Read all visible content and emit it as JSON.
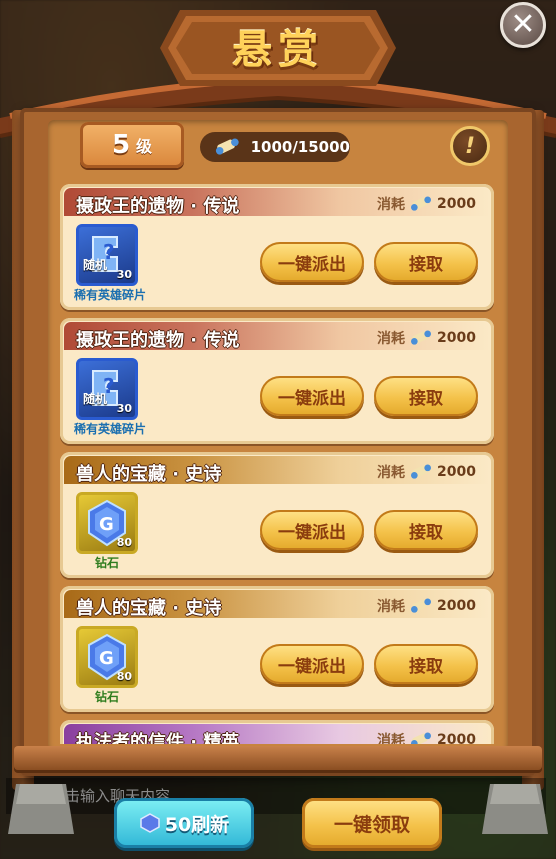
{
  "header": {
    "title": "悬赏",
    "close_icon": "close-icon"
  },
  "level": {
    "number": "5",
    "unit": "级"
  },
  "scrolls": {
    "value": "1000/15000",
    "icon": "scroll-icon"
  },
  "info": {
    "icon": "exclamation-icon",
    "glyph": "!"
  },
  "cost_label": "消耗",
  "quests": [
    {
      "title": "摄政王的遗物 · 传说",
      "tier": "legend",
      "cost": "2000",
      "reward_tag": "随机",
      "reward_count": "30",
      "reward_name": "稀有英雄碎片",
      "reward_kind": "hero",
      "dispatch_label": "一键派出",
      "accept_label": "接取"
    },
    {
      "title": "摄政王的遗物 · 传说",
      "tier": "legend",
      "cost": "2000",
      "reward_tag": "随机",
      "reward_count": "30",
      "reward_name": "稀有英雄碎片",
      "reward_kind": "hero",
      "dispatch_label": "一键派出",
      "accept_label": "接取"
    },
    {
      "title": "兽人的宝藏 · 史诗",
      "tier": "epic",
      "cost": "2000",
      "reward_tag": "",
      "reward_count": "80",
      "reward_name": "钻石",
      "reward_kind": "gem",
      "dispatch_label": "一键派出",
      "accept_label": "接取"
    },
    {
      "title": "兽人的宝藏 · 史诗",
      "tier": "epic",
      "cost": "2000",
      "reward_tag": "",
      "reward_count": "80",
      "reward_name": "钻石",
      "reward_kind": "gem",
      "dispatch_label": "一键派出",
      "accept_label": "接取"
    },
    {
      "title": "执法者的信件 · 精英",
      "tier": "elite",
      "cost": "2000"
    }
  ],
  "footer": {
    "chat_placeholder": "点击输入聊天内容",
    "refresh_label": "50刷新",
    "collect_label": "一键领取"
  },
  "colors": {
    "legend": "#b04a36",
    "epic": "#a86a18",
    "elite": "#8a3f9e",
    "button_gold": "#f4c24a",
    "button_cyan": "#2fb6d6"
  }
}
